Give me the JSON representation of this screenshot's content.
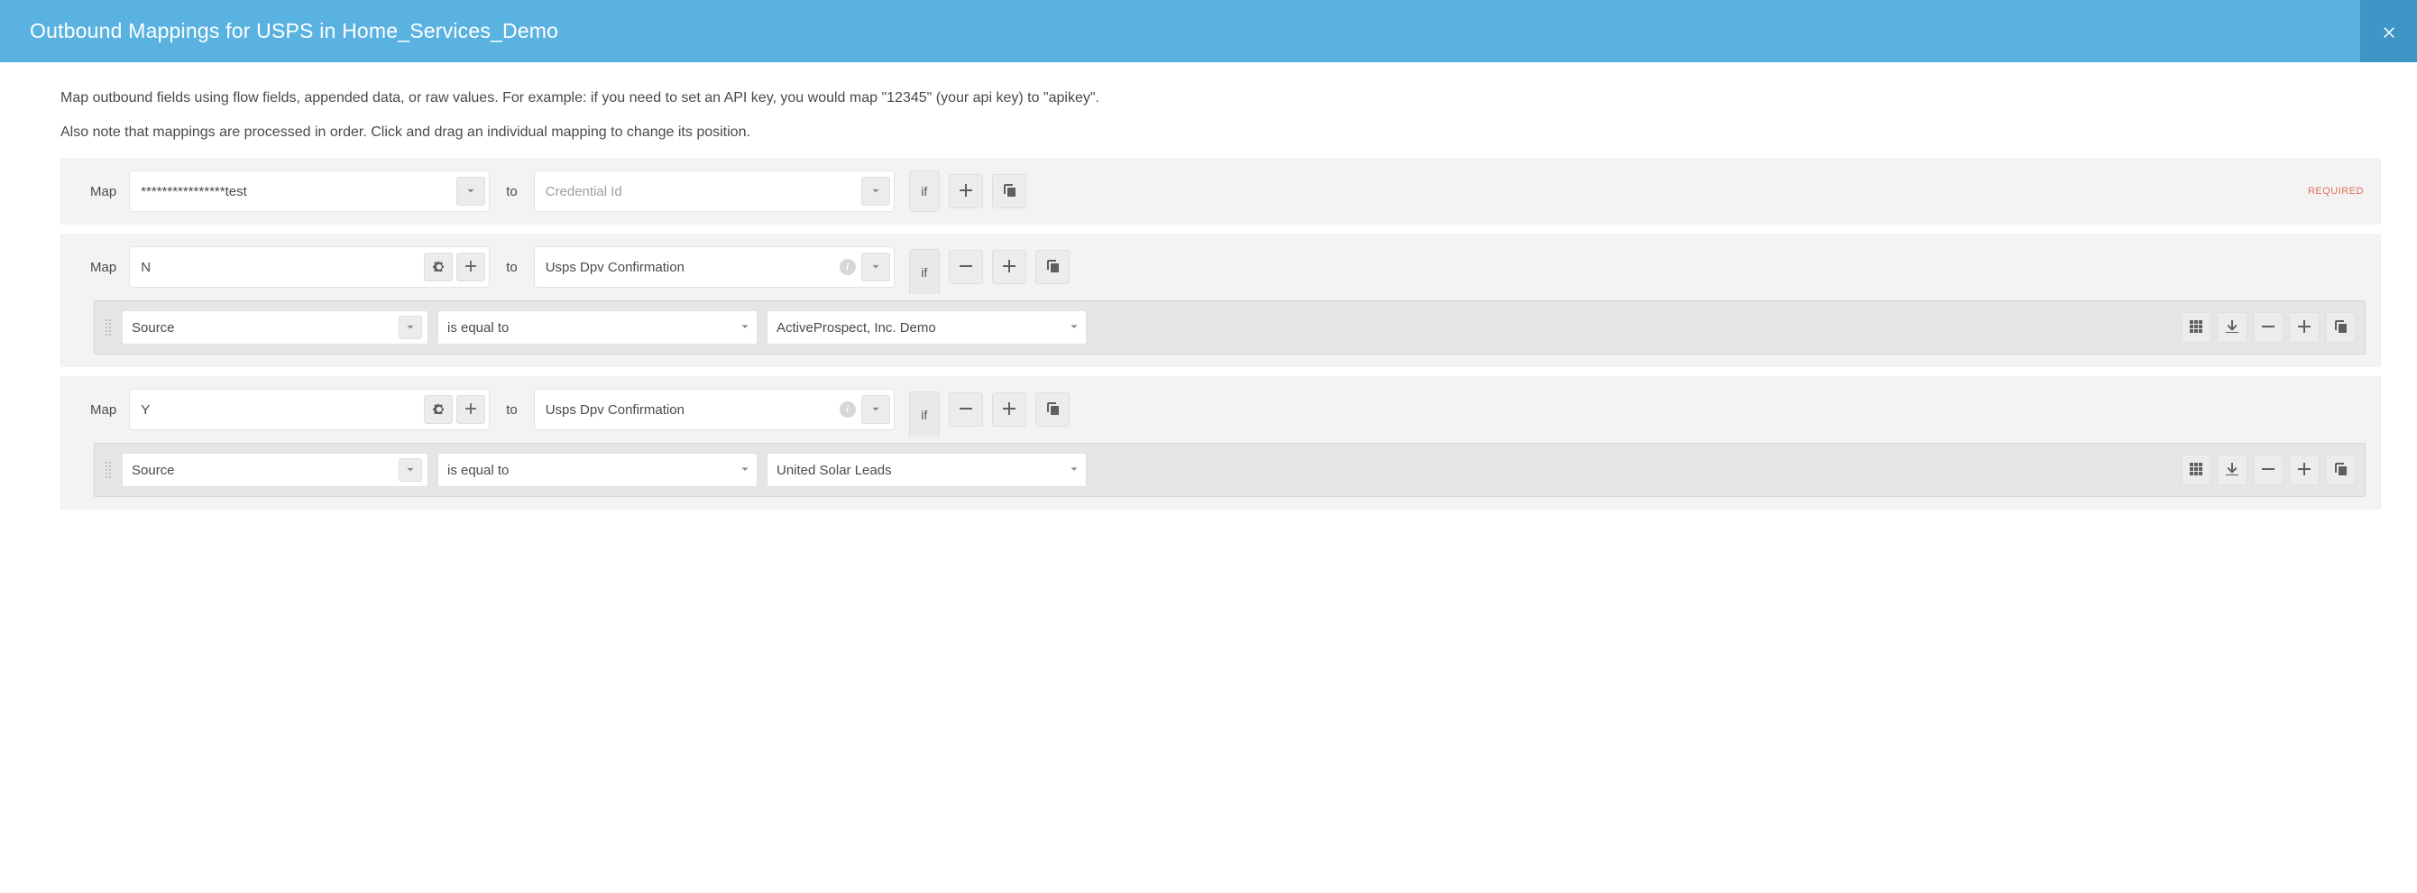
{
  "header": {
    "title": "Outbound Mappings for USPS in Home_Services_Demo"
  },
  "intro": {
    "line1": "Map outbound fields using flow fields, appended data, or raw values. For example: if you need to set an API key, you would map \"12345\" (your api key) to \"apikey\".",
    "line2": "Also note that mappings are processed in order. Click and drag an individual mapping to change its position."
  },
  "labels": {
    "map": "Map",
    "to": "to",
    "if": "if",
    "required": "REQUIRED"
  },
  "mappings": [
    {
      "source_value": "****************test",
      "target_text": "Credential Id",
      "target_placeholder": true,
      "required": true,
      "source_gear": false,
      "source_plus": false,
      "source_caret": true,
      "target_caret": true,
      "target_info": false,
      "if_attached": false,
      "row_actions": [
        "plus",
        "copy"
      ],
      "rule": null
    },
    {
      "source_value": "N",
      "target_text": "Usps Dpv Confirmation",
      "target_placeholder": false,
      "required": false,
      "source_gear": true,
      "source_plus": true,
      "source_caret": false,
      "target_caret": true,
      "target_info": true,
      "if_attached": true,
      "row_actions": [
        "minus",
        "plus",
        "copy"
      ],
      "rule": {
        "field": "Source",
        "operator": "is equal to",
        "value": "ActiveProspect, Inc. Demo",
        "actions": [
          "grid",
          "insert",
          "minus",
          "plus",
          "copy"
        ]
      }
    },
    {
      "source_value": "Y",
      "target_text": "Usps Dpv Confirmation",
      "target_placeholder": false,
      "required": false,
      "source_gear": true,
      "source_plus": true,
      "source_caret": false,
      "target_caret": true,
      "target_info": true,
      "if_attached": true,
      "row_actions": [
        "minus",
        "plus",
        "copy"
      ],
      "rule": {
        "field": "Source",
        "operator": "is equal to",
        "value": "United Solar Leads",
        "actions": [
          "grid",
          "insert",
          "minus",
          "plus",
          "copy"
        ]
      }
    }
  ]
}
